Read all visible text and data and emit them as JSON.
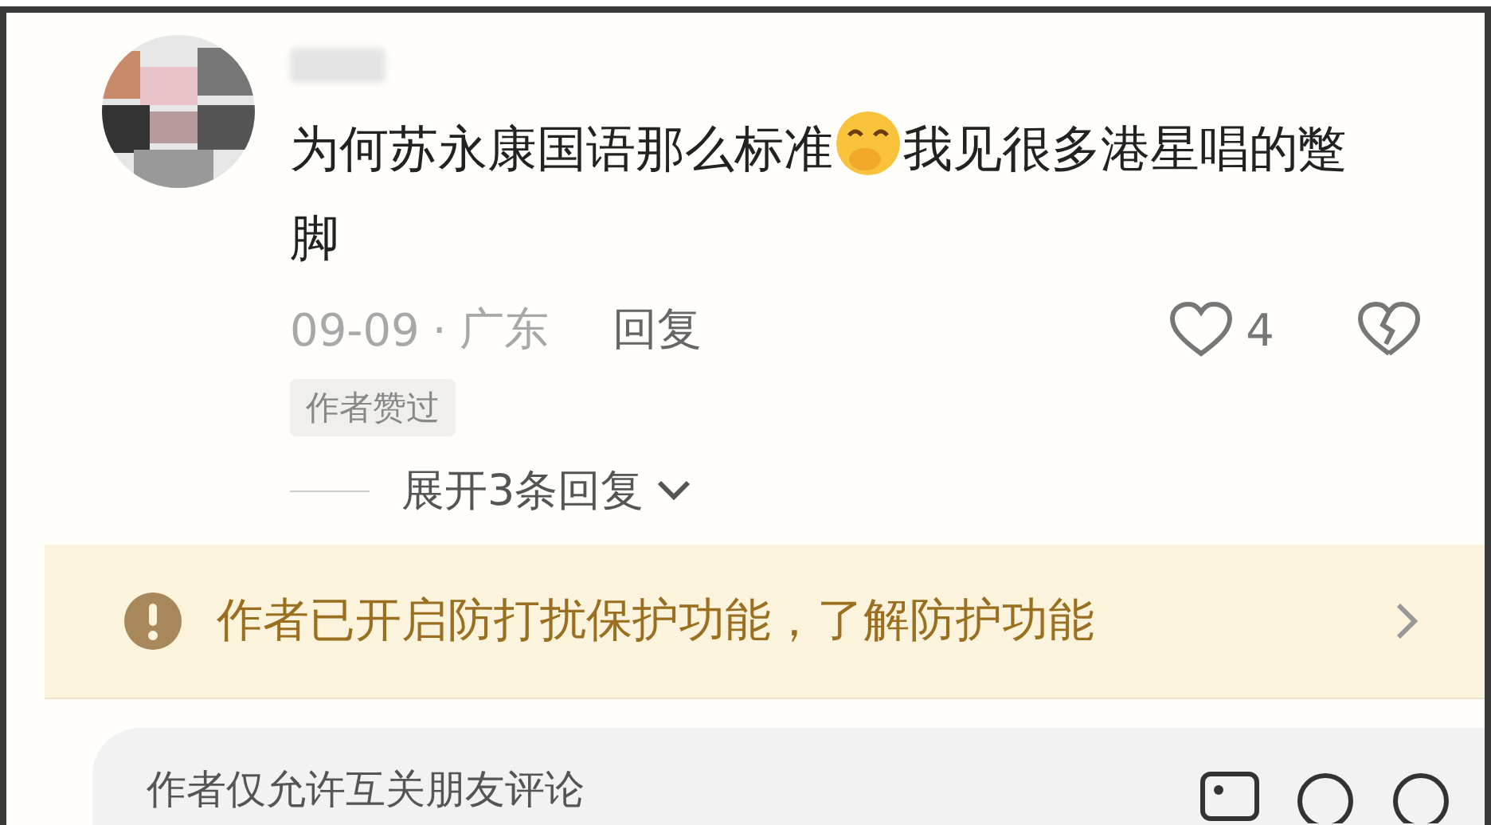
{
  "comment": {
    "content": [
      {
        "kind": "text",
        "text": "为何苏永康国语那么标准"
      },
      {
        "kind": "emoji"
      },
      {
        "kind": "text",
        "text": "我见很多港星唱的蹩脚"
      }
    ],
    "date": "09-09",
    "separator": "·",
    "location": "广东",
    "reply": "回复",
    "likes": "4",
    "liked": false,
    "badge": "作者赞过",
    "expand": "展开3条回复"
  },
  "notice": {
    "text": "作者已开启防打扰保护功能，了解防护功能"
  },
  "composer": {
    "placeholder": "作者仅允许互关朋友评论"
  }
}
